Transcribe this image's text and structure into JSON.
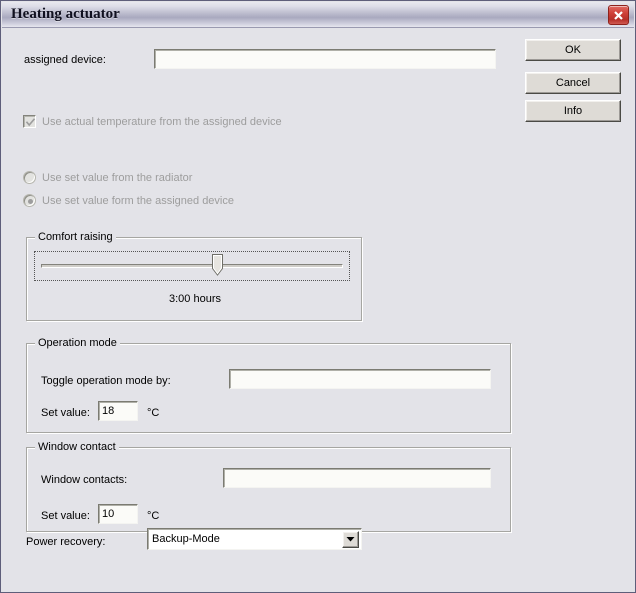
{
  "window": {
    "title": "Heating actuator",
    "close_icon": "close-x-icon"
  },
  "buttons": {
    "ok": "OK",
    "cancel": "Cancel",
    "info": "Info"
  },
  "assigned_device": {
    "label": "assigned device:",
    "value": "",
    "checkbox_label": "Use actual temperature from the assigned device",
    "checkbox_checked": true,
    "checkbox_enabled": false
  },
  "set_value_source": {
    "option_radiator": "Use set value from the radiator",
    "option_assigned_device": "Use set value form the assigned device",
    "selected": "assigned_device",
    "enabled": false
  },
  "comfort_raising": {
    "title": "Comfort raising",
    "value_text": "3:00 hours",
    "slider_percent": 60
  },
  "operation_mode": {
    "title": "Operation mode",
    "toggle_label": "Toggle operation mode by:",
    "toggle_value": "",
    "set_value_label": "Set value:",
    "set_value": "18",
    "unit": "°C"
  },
  "window_contact": {
    "title": "Window contact",
    "contacts_label": "Window contacts:",
    "contacts_value": "",
    "set_value_label": "Set value:",
    "set_value": "10",
    "unit": "°C"
  },
  "power_recovery": {
    "label": "Power recovery:",
    "selected": "Backup-Mode",
    "arrow_icon": "chevron-down-icon"
  },
  "colors": {
    "dialog_background": "#e3e3e8",
    "field_background": "#fbfbf8",
    "disabled_text": "#9d9d9d",
    "close_button": "#cf4038",
    "window_border": "#5e5e7a"
  }
}
